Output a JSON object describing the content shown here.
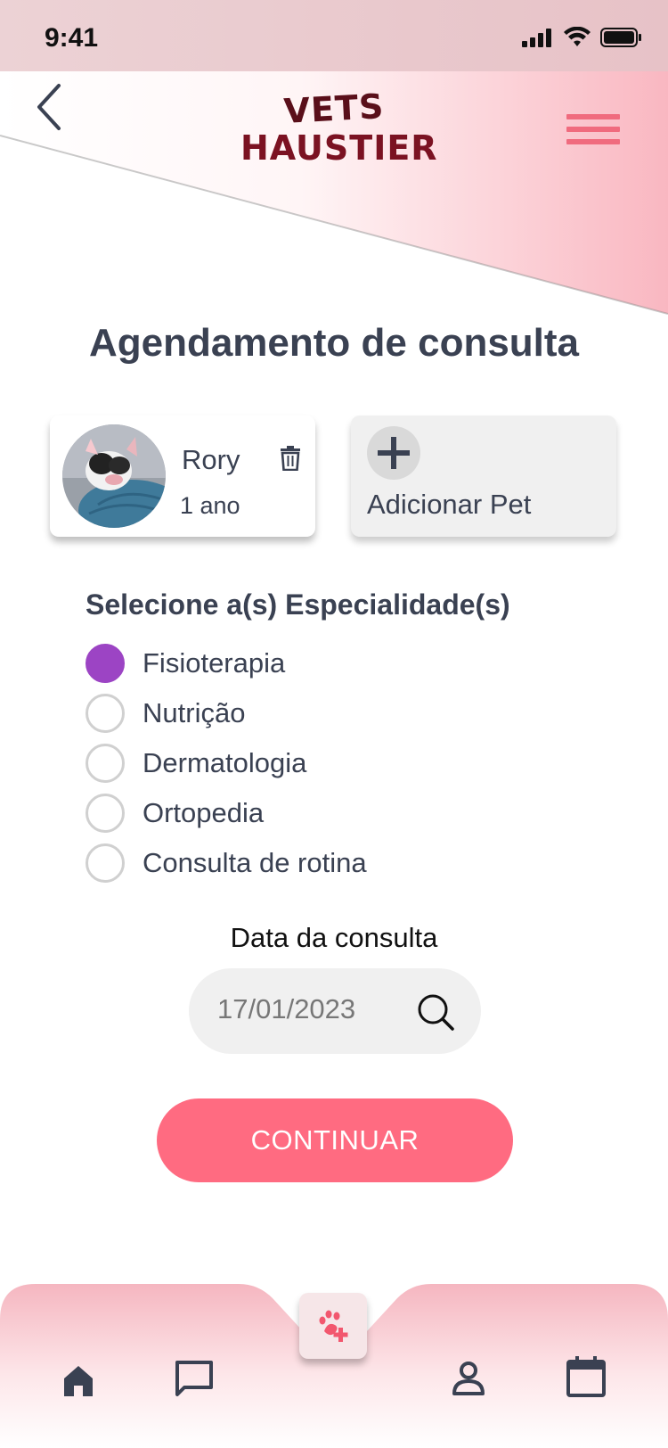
{
  "status_bar": {
    "time": "9:41"
  },
  "header": {
    "logo_line1": "VETS",
    "logo_line2": "HAUSTIER"
  },
  "page": {
    "title": "Agendamento de consulta"
  },
  "pets": [
    {
      "name": "Rory",
      "age": "1 ano"
    }
  ],
  "add_pet": {
    "label": "Adicionar Pet"
  },
  "specialties": {
    "heading": "Selecione a(s) Especialidade(s)",
    "items": [
      {
        "label": "Fisioterapia",
        "checked": true
      },
      {
        "label": "Nutrição",
        "checked": false
      },
      {
        "label": "Dermatologia",
        "checked": false
      },
      {
        "label": "Ortopedia",
        "checked": false
      },
      {
        "label": "Consulta de rotina",
        "checked": false
      }
    ]
  },
  "date": {
    "label": "Data da consulta",
    "value": "17/01/2023"
  },
  "actions": {
    "continue_label": "CONTINUAR"
  },
  "colors": {
    "accent": "#ff6b81",
    "radio_checked": "#9c44c4",
    "text": "#3a4152",
    "nav_pink": "#f5b6c0"
  },
  "nav": {
    "items": [
      "home-icon",
      "chat-icon",
      "add-pet-icon",
      "profile-icon",
      "calendar-icon"
    ]
  }
}
